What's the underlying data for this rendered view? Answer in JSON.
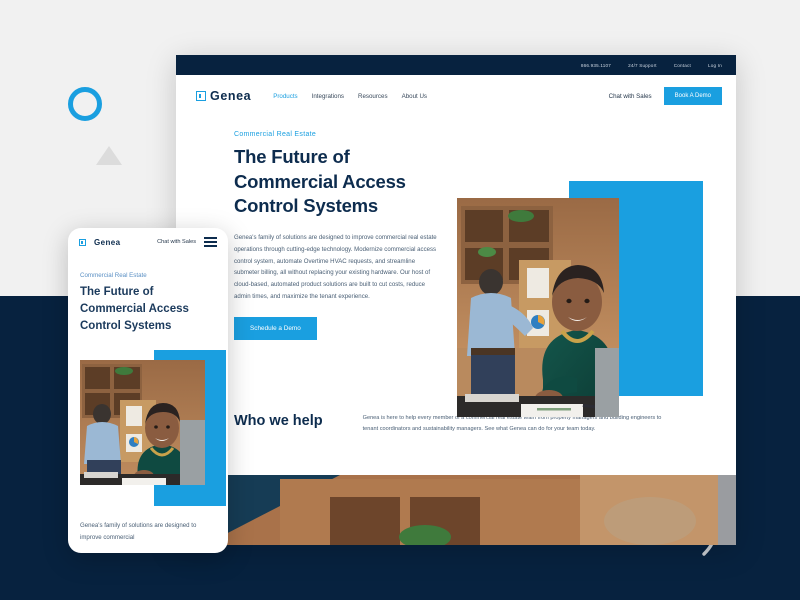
{
  "colors": {
    "brand_blue": "#1a9fe0",
    "navy": "#07223f",
    "page_bg_top": "#f1f1f1",
    "page_bg_bottom": "#07223f",
    "body_text": "#4b6076",
    "heading": "#0d2c4e"
  },
  "desktop": {
    "topbar": {
      "phone": "866.935.1107",
      "support": "24/7 Support",
      "contact": "Contact",
      "login": "Log In"
    },
    "navbar": {
      "logo_text": "Genea",
      "links": [
        {
          "label": "Products",
          "active": true
        },
        {
          "label": "Integrations",
          "active": false
        },
        {
          "label": "Resources",
          "active": false
        },
        {
          "label": "About Us",
          "active": false
        }
      ],
      "chat_label": "Chat with Sales",
      "demo_button": "Book A Demo"
    },
    "hero": {
      "eyebrow": "Commercial Real Estate",
      "headline_line1": "The Future of",
      "headline_line2": "Commercial Access",
      "headline_line3": "Control Systems",
      "body": "Genea's family of solutions are designed to improve commercial real estate operations through cutting-edge technology. Modernize commercial access control system, automate Overtime HVAC requests, and streamline submeter billing, all without replacing your existing hardware. Our host of cloud-based, automated product solutions are built to cut costs, reduce admin times, and maximize the tenant experience.",
      "cta_button": "Schedule a Demo"
    },
    "who_we_help": {
      "title": "Who we help",
      "body": "Genea is here to help every member of a commercial real estate team from property managers and building engineers to tenant coordinators and sustainability managers. See what Genea can do for your team today."
    }
  },
  "mobile": {
    "navbar": {
      "logo_text": "Genea",
      "chat_label": "Chat with Sales"
    },
    "hero": {
      "eyebrow": "Commercial Real Estate",
      "headline_line1": "The Future of",
      "headline_line2": "Commercial Access",
      "headline_line3": "Control Systems",
      "body": "Genea's family of solutions are designed to improve commercial"
    }
  },
  "decorations": {
    "circle": "circle-outline-shape",
    "triangle": "triangle-shape",
    "squiggle": "squiggle-line-shape"
  }
}
